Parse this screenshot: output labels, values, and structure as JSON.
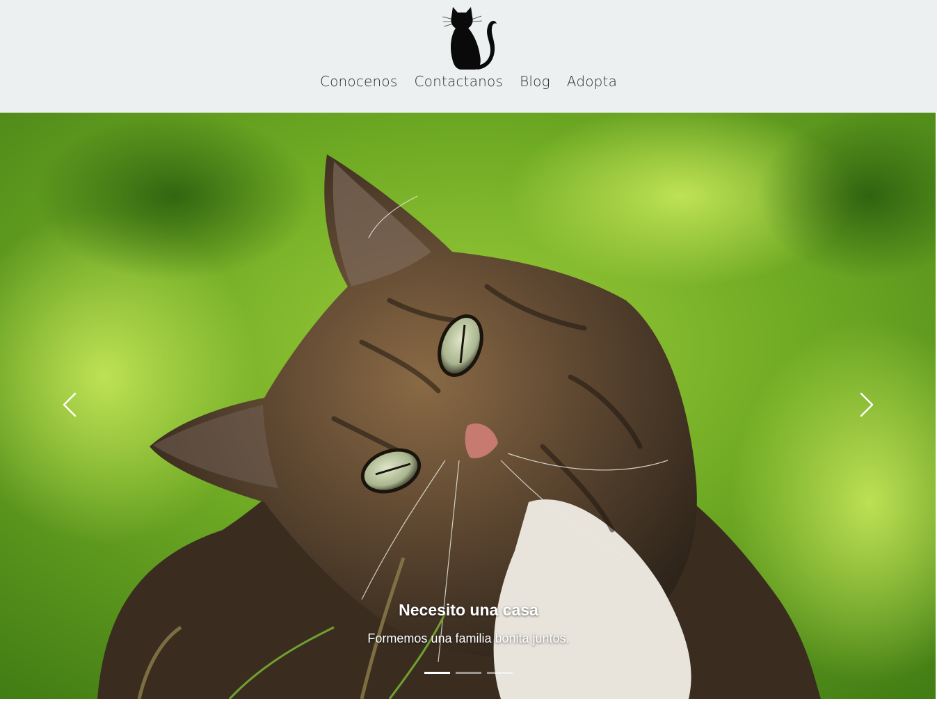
{
  "header": {
    "logo_icon": "cat-silhouette-icon",
    "nav": [
      {
        "label": "Conocenos"
      },
      {
        "label": "Contactanos"
      },
      {
        "label": "Blog"
      },
      {
        "label": "Adopta"
      }
    ]
  },
  "carousel": {
    "image": "tabby-cat-in-grass-photo",
    "prev_icon": "chevron-left-icon",
    "next_icon": "chevron-right-icon",
    "caption_title": "Necesito una casa",
    "caption_text": "Formemos una familia bonita juntos.",
    "indicator_count": 3,
    "active_indicator": 1
  },
  "colors": {
    "header_bg": "#edf0f1",
    "nav_text": "#2b2b2b",
    "background_green": "#7fbf2a",
    "caption_text": "#ffffff"
  }
}
